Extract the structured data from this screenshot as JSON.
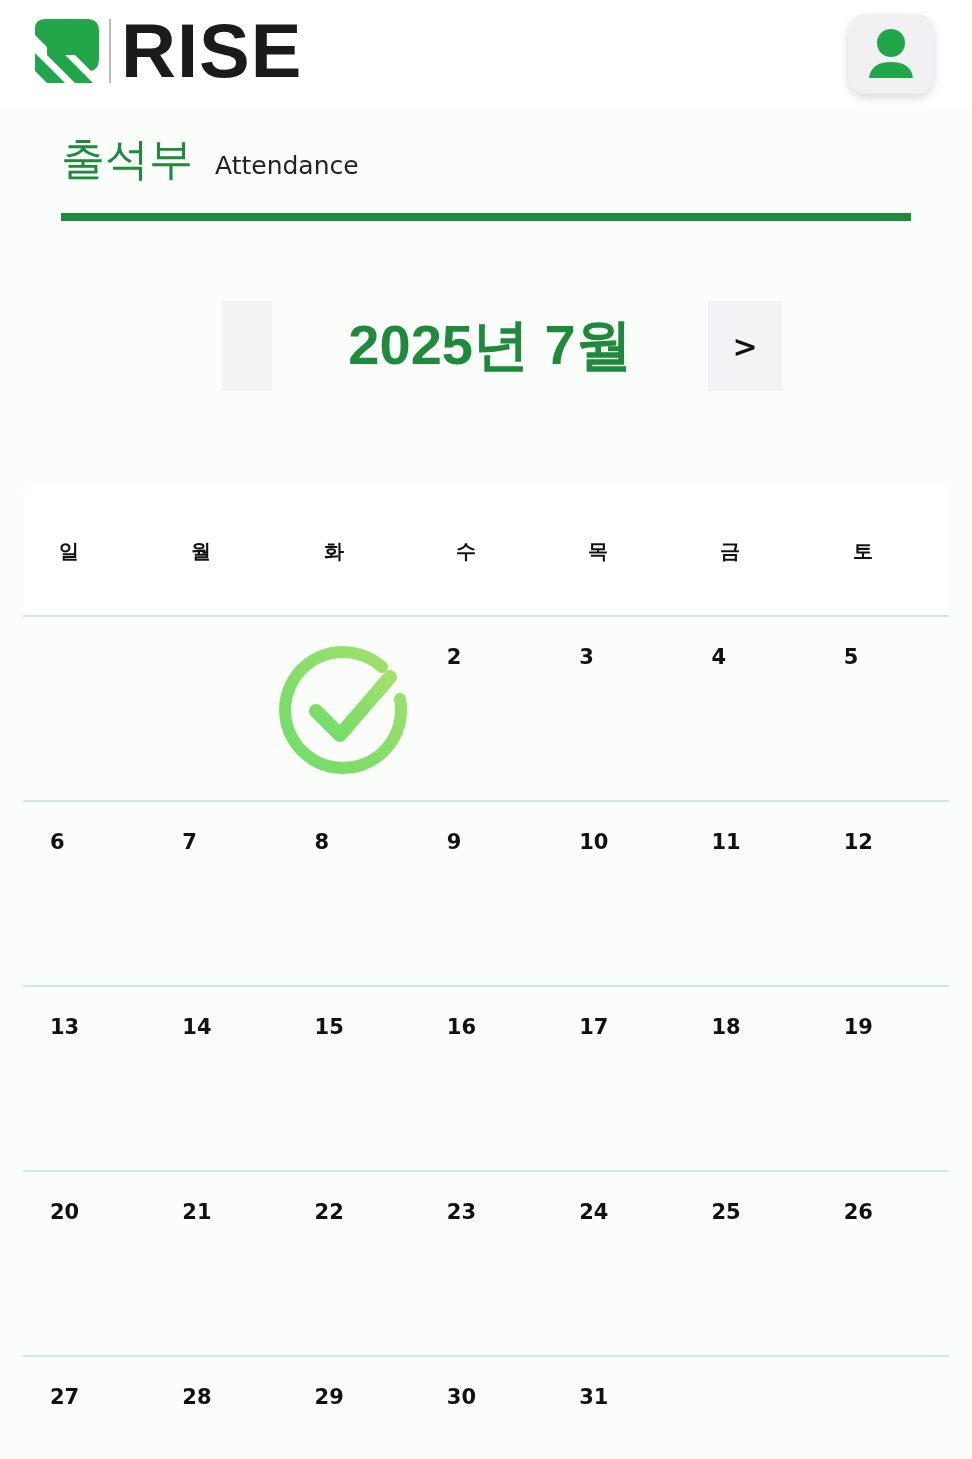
{
  "logo": {
    "text": "RISE"
  },
  "title": {
    "korean": "출석부",
    "english": "Attendance"
  },
  "month_nav": {
    "title": "2025년 7월",
    "next": ">"
  },
  "calendar": {
    "weekdays": [
      "일",
      "월",
      "화",
      "수",
      "목",
      "금",
      "토"
    ],
    "weeks": [
      [
        {
          "kind": "blank"
        },
        {
          "kind": "blank"
        },
        {
          "kind": "day",
          "attended": true
        },
        {
          "kind": "day",
          "day": "2",
          "attended": false
        },
        {
          "day": "3",
          "attended": false
        },
        {
          "day": "4",
          "attended": false
        },
        {
          "day": "5",
          "attended": false
        }
      ],
      [
        {
          "day": "6",
          "attended": false
        },
        {
          "day": "7",
          "attended": false
        },
        {
          "day": "8",
          "attended": false
        },
        {
          "day": "9",
          "attended": false
        },
        {
          "day": "10",
          "attended": false
        },
        {
          "day": "11",
          "attended": false
        },
        {
          "day": "12",
          "attended": false
        }
      ],
      [
        {
          "day": "13",
          "attended": false
        },
        {
          "day": "14",
          "attended": false
        },
        {
          "day": "15",
          "attended": false
        },
        {
          "day": "16",
          "attended": false
        },
        {
          "day": "17",
          "attended": false
        },
        {
          "day": "18",
          "attended": false
        },
        {
          "day": "19",
          "attended": false
        }
      ],
      [
        {
          "day": "20",
          "attended": false
        },
        {
          "day": "21",
          "attended": false
        },
        {
          "day": "22",
          "attended": false
        },
        {
          "day": "23",
          "attended": false
        },
        {
          "day": "24",
          "attended": false
        },
        {
          "day": "25",
          "attended": false
        },
        {
          "day": "26",
          "attended": false
        }
      ],
      [
        {
          "day": "27",
          "attended": false
        },
        {
          "day": "28",
          "attended": false
        },
        {
          "day": "29",
          "attended": false
        },
        {
          "day": "30",
          "attended": false
        },
        {
          "day": "31",
          "attended": false
        },
        {
          "kind": "blank"
        },
        {
          "kind": "blank"
        }
      ]
    ]
  }
}
